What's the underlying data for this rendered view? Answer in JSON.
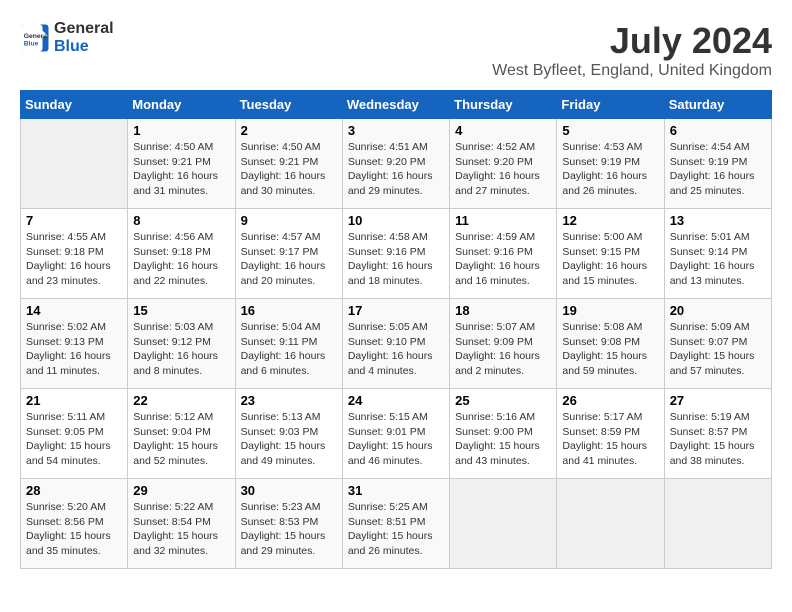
{
  "header": {
    "logo_general": "General",
    "logo_blue": "Blue",
    "title": "July 2024",
    "subtitle": "West Byfleet, England, United Kingdom"
  },
  "calendar": {
    "days_of_week": [
      "Sunday",
      "Monday",
      "Tuesday",
      "Wednesday",
      "Thursday",
      "Friday",
      "Saturday"
    ],
    "weeks": [
      [
        {
          "day": "",
          "info": ""
        },
        {
          "day": "1",
          "info": "Sunrise: 4:50 AM\nSunset: 9:21 PM\nDaylight: 16 hours\nand 31 minutes."
        },
        {
          "day": "2",
          "info": "Sunrise: 4:50 AM\nSunset: 9:21 PM\nDaylight: 16 hours\nand 30 minutes."
        },
        {
          "day": "3",
          "info": "Sunrise: 4:51 AM\nSunset: 9:20 PM\nDaylight: 16 hours\nand 29 minutes."
        },
        {
          "day": "4",
          "info": "Sunrise: 4:52 AM\nSunset: 9:20 PM\nDaylight: 16 hours\nand 27 minutes."
        },
        {
          "day": "5",
          "info": "Sunrise: 4:53 AM\nSunset: 9:19 PM\nDaylight: 16 hours\nand 26 minutes."
        },
        {
          "day": "6",
          "info": "Sunrise: 4:54 AM\nSunset: 9:19 PM\nDaylight: 16 hours\nand 25 minutes."
        }
      ],
      [
        {
          "day": "7",
          "info": "Sunrise: 4:55 AM\nSunset: 9:18 PM\nDaylight: 16 hours\nand 23 minutes."
        },
        {
          "day": "8",
          "info": "Sunrise: 4:56 AM\nSunset: 9:18 PM\nDaylight: 16 hours\nand 22 minutes."
        },
        {
          "day": "9",
          "info": "Sunrise: 4:57 AM\nSunset: 9:17 PM\nDaylight: 16 hours\nand 20 minutes."
        },
        {
          "day": "10",
          "info": "Sunrise: 4:58 AM\nSunset: 9:16 PM\nDaylight: 16 hours\nand 18 minutes."
        },
        {
          "day": "11",
          "info": "Sunrise: 4:59 AM\nSunset: 9:16 PM\nDaylight: 16 hours\nand 16 minutes."
        },
        {
          "day": "12",
          "info": "Sunrise: 5:00 AM\nSunset: 9:15 PM\nDaylight: 16 hours\nand 15 minutes."
        },
        {
          "day": "13",
          "info": "Sunrise: 5:01 AM\nSunset: 9:14 PM\nDaylight: 16 hours\nand 13 minutes."
        }
      ],
      [
        {
          "day": "14",
          "info": "Sunrise: 5:02 AM\nSunset: 9:13 PM\nDaylight: 16 hours\nand 11 minutes."
        },
        {
          "day": "15",
          "info": "Sunrise: 5:03 AM\nSunset: 9:12 PM\nDaylight: 16 hours\nand 8 minutes."
        },
        {
          "day": "16",
          "info": "Sunrise: 5:04 AM\nSunset: 9:11 PM\nDaylight: 16 hours\nand 6 minutes."
        },
        {
          "day": "17",
          "info": "Sunrise: 5:05 AM\nSunset: 9:10 PM\nDaylight: 16 hours\nand 4 minutes."
        },
        {
          "day": "18",
          "info": "Sunrise: 5:07 AM\nSunset: 9:09 PM\nDaylight: 16 hours\nand 2 minutes."
        },
        {
          "day": "19",
          "info": "Sunrise: 5:08 AM\nSunset: 9:08 PM\nDaylight: 15 hours\nand 59 minutes."
        },
        {
          "day": "20",
          "info": "Sunrise: 5:09 AM\nSunset: 9:07 PM\nDaylight: 15 hours\nand 57 minutes."
        }
      ],
      [
        {
          "day": "21",
          "info": "Sunrise: 5:11 AM\nSunset: 9:05 PM\nDaylight: 15 hours\nand 54 minutes."
        },
        {
          "day": "22",
          "info": "Sunrise: 5:12 AM\nSunset: 9:04 PM\nDaylight: 15 hours\nand 52 minutes."
        },
        {
          "day": "23",
          "info": "Sunrise: 5:13 AM\nSunset: 9:03 PM\nDaylight: 15 hours\nand 49 minutes."
        },
        {
          "day": "24",
          "info": "Sunrise: 5:15 AM\nSunset: 9:01 PM\nDaylight: 15 hours\nand 46 minutes."
        },
        {
          "day": "25",
          "info": "Sunrise: 5:16 AM\nSunset: 9:00 PM\nDaylight: 15 hours\nand 43 minutes."
        },
        {
          "day": "26",
          "info": "Sunrise: 5:17 AM\nSunset: 8:59 PM\nDaylight: 15 hours\nand 41 minutes."
        },
        {
          "day": "27",
          "info": "Sunrise: 5:19 AM\nSunset: 8:57 PM\nDaylight: 15 hours\nand 38 minutes."
        }
      ],
      [
        {
          "day": "28",
          "info": "Sunrise: 5:20 AM\nSunset: 8:56 PM\nDaylight: 15 hours\nand 35 minutes."
        },
        {
          "day": "29",
          "info": "Sunrise: 5:22 AM\nSunset: 8:54 PM\nDaylight: 15 hours\nand 32 minutes."
        },
        {
          "day": "30",
          "info": "Sunrise: 5:23 AM\nSunset: 8:53 PM\nDaylight: 15 hours\nand 29 minutes."
        },
        {
          "day": "31",
          "info": "Sunrise: 5:25 AM\nSunset: 8:51 PM\nDaylight: 15 hours\nand 26 minutes."
        },
        {
          "day": "",
          "info": ""
        },
        {
          "day": "",
          "info": ""
        },
        {
          "day": "",
          "info": ""
        }
      ]
    ]
  }
}
